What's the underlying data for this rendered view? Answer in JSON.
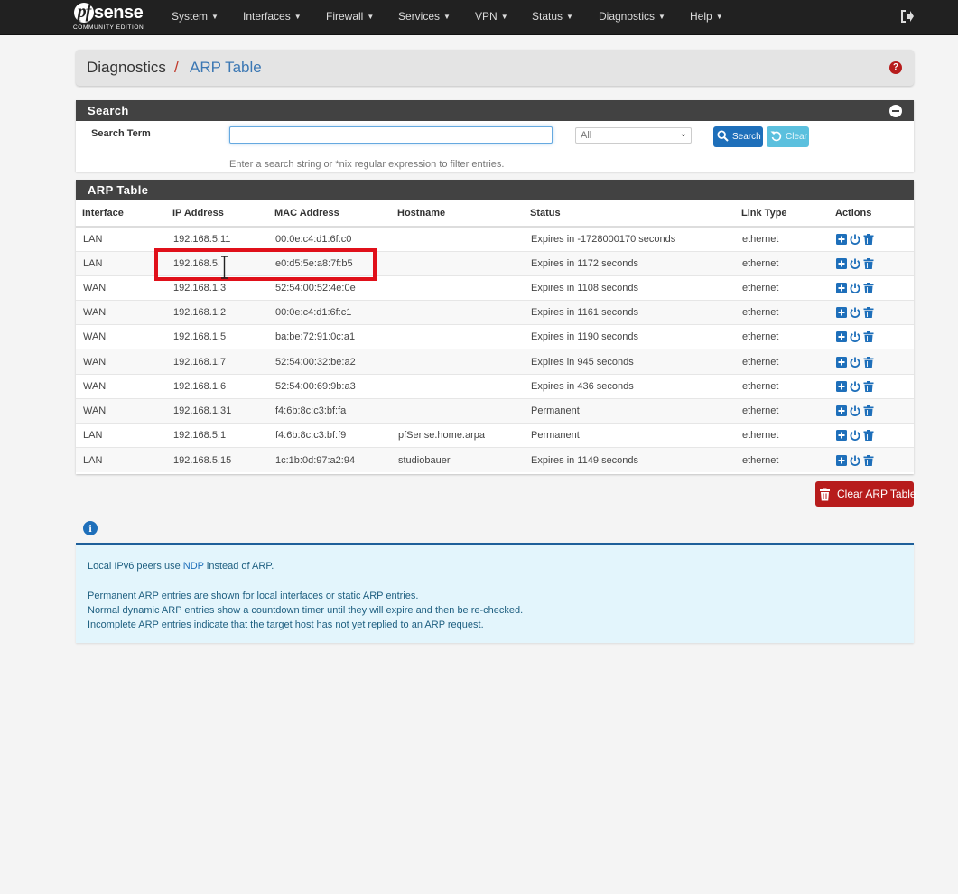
{
  "brand": {
    "logo_main": "sense",
    "logo_badge": "pf",
    "edition": "COMMUNITY EDITION"
  },
  "nav": {
    "items": [
      "System",
      "Interfaces",
      "Firewall",
      "Services",
      "VPN",
      "Status",
      "Diagnostics",
      "Help"
    ]
  },
  "breadcrumb": {
    "root": "Diagnostics",
    "separator": "/",
    "page": "ARP Table"
  },
  "search": {
    "heading": "Search",
    "term_label": "Search Term",
    "term_value": "",
    "help_text": "Enter a search string or *nix regular expression to filter entries.",
    "select_value": "All",
    "search_button": "Search",
    "clear_button": "Clear"
  },
  "arp": {
    "heading": "ARP Table",
    "columns": [
      "Interface",
      "IP Address",
      "MAC Address",
      "Hostname",
      "Status",
      "Link Type",
      "Actions"
    ],
    "rows": [
      {
        "interface": "LAN",
        "ip": "192.168.5.11",
        "mac": "00:0e:c4:d1:6f:c0",
        "hostname": "",
        "status": "Expires in -1728000170 seconds",
        "link": "ethernet"
      },
      {
        "interface": "LAN",
        "ip": "192.168.5.",
        "mac": "e0:d5:5e:a8:7f:b5",
        "hostname": "",
        "status": "Expires in 1172 seconds",
        "link": "ethernet"
      },
      {
        "interface": "WAN",
        "ip": "192.168.1.3",
        "mac": "52:54:00:52:4e:0e",
        "hostname": "",
        "status": "Expires in 1108 seconds",
        "link": "ethernet"
      },
      {
        "interface": "WAN",
        "ip": "192.168.1.2",
        "mac": "00:0e:c4:d1:6f:c1",
        "hostname": "",
        "status": "Expires in 1161 seconds",
        "link": "ethernet"
      },
      {
        "interface": "WAN",
        "ip": "192.168.1.5",
        "mac": "ba:be:72:91:0c:a1",
        "hostname": "",
        "status": "Expires in 1190 seconds",
        "link": "ethernet"
      },
      {
        "interface": "WAN",
        "ip": "192.168.1.7",
        "mac": "52:54:00:32:be:a2",
        "hostname": "",
        "status": "Expires in 945 seconds",
        "link": "ethernet"
      },
      {
        "interface": "WAN",
        "ip": "192.168.1.6",
        "mac": "52:54:00:69:9b:a3",
        "hostname": "",
        "status": "Expires in 436 seconds",
        "link": "ethernet"
      },
      {
        "interface": "WAN",
        "ip": "192.168.1.31",
        "mac": "f4:6b:8c:c3:bf:fa",
        "hostname": "",
        "status": "Permanent",
        "link": "ethernet"
      },
      {
        "interface": "LAN",
        "ip": "192.168.5.1",
        "mac": "f4:6b:8c:c3:bf:f9",
        "hostname": "pfSense.home.arpa",
        "status": "Permanent",
        "link": "ethernet"
      },
      {
        "interface": "LAN",
        "ip": "192.168.5.15",
        "mac": "1c:1b:0d:97:a2:94",
        "hostname": "studiobauer",
        "status": "Expires in 1149 seconds",
        "link": "ethernet"
      }
    ],
    "action_icons": [
      "plus-square-icon",
      "power-icon",
      "trash-icon"
    ],
    "clear_button": "Clear ARP Table"
  },
  "info": {
    "line1_prefix": "Local IPv6 peers use ",
    "line1_link": "NDP",
    "line1_suffix": " instead of ARP.",
    "line2": "Permanent ARP entries are shown for local interfaces or static ARP entries.",
    "line3": "Normal dynamic ARP entries show a countdown timer until they will expire and then be re-checked.",
    "line4": "Incomplete ARP entries indicate that the target host has not yet replied to an ARP request."
  },
  "colors": {
    "navbar": "#212121",
    "panel_heading": "#424242",
    "primary": "#1e6fba",
    "info_btn": "#5bc0de",
    "danger": "#b71c1c",
    "highlight": "#e0101a",
    "info_bg": "#e3f5fc"
  }
}
